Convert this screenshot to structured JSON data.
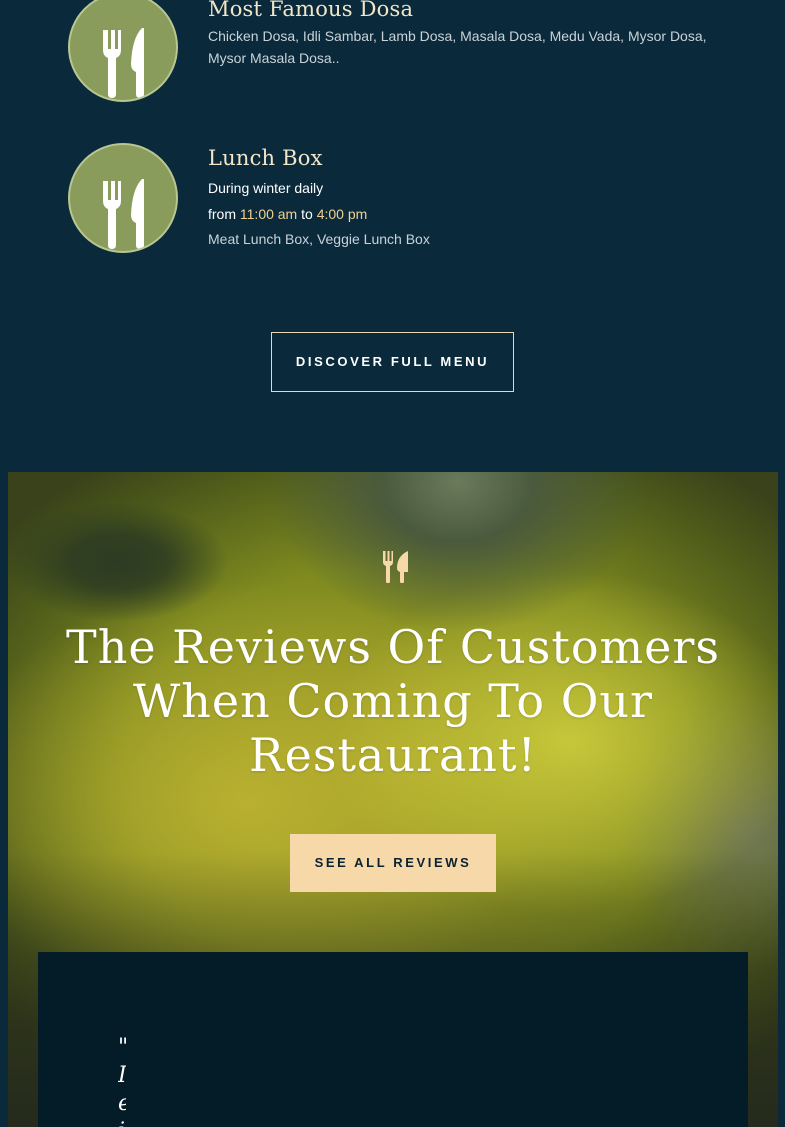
{
  "menu": {
    "items": [
      {
        "title": "Most Famous Dosa",
        "description": "Chicken Dosa, Idli Sambar, Lamb Dosa, Masala Dosa, Medu Vada, Mysor Dosa, Mysor Masala Dosa.."
      },
      {
        "title": "Lunch Box",
        "schedule": "During winter daily",
        "from_label": "from",
        "start_time": "11:00 am",
        "to_label": "to",
        "end_time": "4:00 pm",
        "description": "Meat Lunch Box, Veggie Lunch Box"
      }
    ],
    "icon": "fork-knife-icon",
    "discover_button": "DISCOVER FULL MENU"
  },
  "reviews": {
    "icon": "fork-knife-icon",
    "title": "The Reviews Of Customers When Coming To Our Restaurant!",
    "button": "SEE ALL REVIEWS",
    "card_glyph": "\" I e i"
  },
  "colors": {
    "page_background": "#0a2a3c",
    "plate": "#8a9c5c",
    "title": "#f3e6c8",
    "accent": "#f2d08d",
    "reviews_button": "#f6d8a9",
    "card": "#041c28"
  }
}
